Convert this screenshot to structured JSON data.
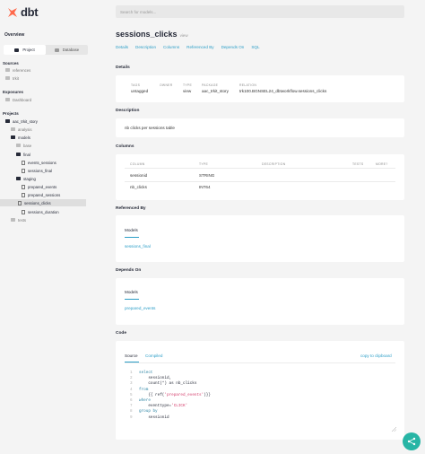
{
  "brand": {
    "name": "dbt"
  },
  "search": {
    "placeholder": "Search for models..."
  },
  "sidebar": {
    "overview": "Overview",
    "tabs": [
      "Project",
      "Database"
    ],
    "sources_title": "Sources",
    "sources": [
      "references",
      "trkit"
    ],
    "exposures_title": "Exposures",
    "exposures": [
      "Dashboard"
    ],
    "projects_title": "Projects",
    "tree": {
      "root": "aac_trkit_story",
      "analysis": "analysis",
      "models": "models",
      "base": "base",
      "final": "final",
      "events_sessions": "events_sessions",
      "sessions_final": "sessions_final",
      "staging": "staging",
      "prepared_events": "prepared_events",
      "prepared_sessions": "prepared_sessions",
      "sessions_clicks": "sessions_clicks",
      "sessions_duration": "sessions_duration",
      "tests": "tests"
    }
  },
  "page": {
    "title": "sessions_clicks",
    "subtitle": "view",
    "nav": [
      "Details",
      "Description",
      "Columns",
      "Referenced By",
      "Depends On",
      "SQL"
    ]
  },
  "details": {
    "title": "Details",
    "labels": [
      "TAGS",
      "OWNER",
      "TYPE",
      "PACKAGE",
      "RELATION"
    ],
    "values": [
      "untagged",
      "",
      "view",
      "aac_trkit_story",
      "trk100.BGNSEL24_dbtworkflow.sessions_clicks"
    ]
  },
  "description": {
    "title": "Description",
    "text": "nb clicks per sessions table"
  },
  "columns": {
    "title": "Columns",
    "headers": [
      "COLUMN",
      "TYPE",
      "DESCRIPTION",
      "TESTS",
      "MORE?"
    ],
    "rows": [
      [
        "sessionid",
        "STRING"
      ],
      [
        "nb_clicks",
        "INT64"
      ]
    ]
  },
  "referenced_by": {
    "title": "Referenced By",
    "tab": "Models",
    "items": [
      "sessions_final"
    ]
  },
  "depends_on": {
    "title": "Depends On",
    "tab": "Models",
    "items": [
      "prepared_events"
    ]
  },
  "code": {
    "title": "Code",
    "tabs": [
      "Source",
      "Compiled"
    ],
    "copy": "copy to clipboard",
    "lines": [
      {
        "n": "1",
        "a": "select",
        "b": "",
        "c": ""
      },
      {
        "n": "2",
        "a": "",
        "b": "    sessionid,",
        "c": ""
      },
      {
        "n": "3",
        "a": "",
        "b": "    count(*) as nb_clicks",
        "c": ""
      },
      {
        "n": "4",
        "a": "from",
        "b": "",
        "c": ""
      },
      {
        "n": "5",
        "a": "",
        "b": "    {{ ref(",
        "c": "'prepared_events'"
      },
      {
        "n": "6",
        "a": "where",
        "b": "",
        "c": ""
      },
      {
        "n": "7",
        "a": "",
        "b": "    eventtype=",
        "c": "'CLICK'"
      },
      {
        "n": "8",
        "a": "group by",
        "b": "",
        "c": ""
      },
      {
        "n": "9",
        "a": "",
        "b": "    sessionid",
        "c": ""
      }
    ],
    "line5_tail": ")}}"
  }
}
